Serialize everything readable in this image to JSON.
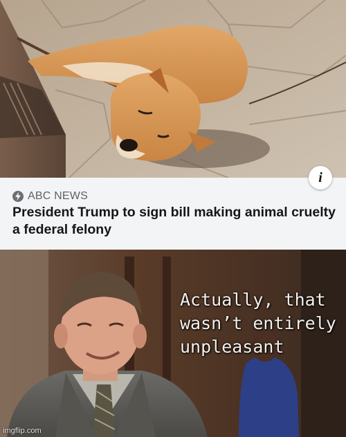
{
  "top_image": {
    "description_icon": "info-icon",
    "info_label": "i"
  },
  "article": {
    "source_icon": "lightning-icon",
    "source_name": "ABC NEWS",
    "headline": "President Trump to sign bill making animal cruelty a federal felony"
  },
  "meme_panel": {
    "caption": "Actually, that\nwasn’t entirely\nunpleasant",
    "watermark": "imgflip.com"
  }
}
